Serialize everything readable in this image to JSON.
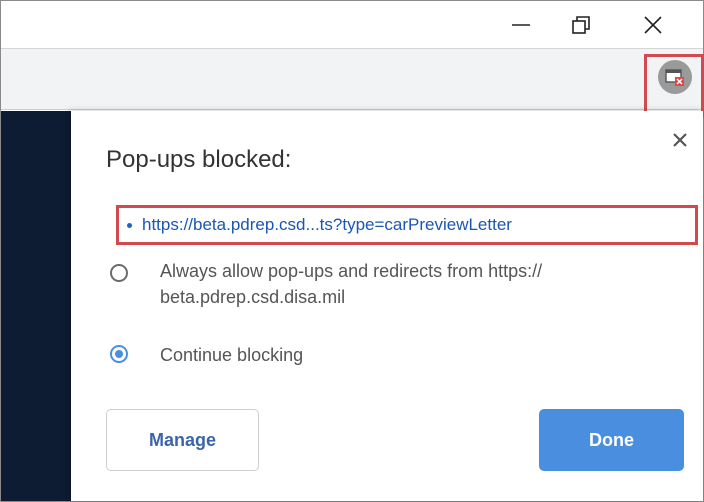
{
  "window": {
    "minimize_label": "Minimize",
    "restore_label": "Restore",
    "close_label": "Close"
  },
  "toolbar": {
    "popup_blocked_icon": "popup-blocked-icon"
  },
  "bubble": {
    "title": "Pop-ups blocked:",
    "blocked_url": "https://beta.pdrep.csd...ts?type=carPreviewLetter",
    "options": [
      {
        "label": "Always allow pop-ups and redirects from https:// beta.pdrep.csd.disa.mil",
        "selected": false
      },
      {
        "label": "Continue blocking",
        "selected": true
      }
    ],
    "manage_label": "Manage",
    "done_label": "Done"
  },
  "colors": {
    "accent": "#4a8ee0",
    "link": "#1a56b3",
    "highlight": "#d24a4f",
    "page_background": "#0d1b33"
  }
}
